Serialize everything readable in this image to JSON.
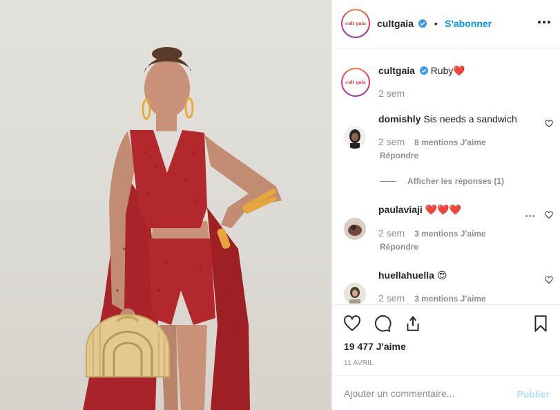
{
  "post": {
    "username": "cultgaia",
    "follow_label": "S'abonner",
    "separator": "•",
    "avatar_logo": "cult gaia"
  },
  "caption": {
    "username": "cultgaia",
    "text": "Ruby",
    "emoji": "❤️",
    "time": "2 sem"
  },
  "comments": [
    {
      "username": "domishly",
      "text": "Sis needs a sandwich",
      "time": "2 sem",
      "likes": "8 mentions J'aime",
      "reply": "Répondre",
      "view_replies": "Afficher les réponses (1)"
    },
    {
      "username": "paulaviaji",
      "text": "❤️❤️❤️",
      "time": "2 sem",
      "likes": "3 mentions J'aime",
      "reply": "Répondre"
    },
    {
      "username": "huellahuella",
      "text": "😍",
      "time": "2 sem",
      "likes": "3 mentions J'aime"
    }
  ],
  "actions": {
    "likes_count": "19 477 J'aime",
    "date": "11 AVRIL"
  },
  "add_comment": {
    "placeholder": "Ajouter un commentaire...",
    "publish_label": "Publier"
  },
  "colors": {
    "accent": "#0095f6",
    "heart_emoji": "#e0245e",
    "dress": "#b3282d",
    "muted_text": "#8e8e8e"
  },
  "icons": [
    "heart-icon",
    "comment-icon",
    "share-icon",
    "bookmark-icon",
    "verified-icon",
    "more-icon"
  ]
}
